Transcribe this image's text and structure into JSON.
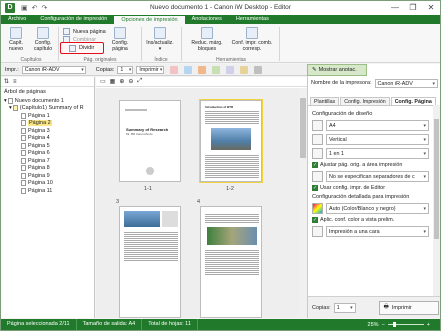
{
  "window": {
    "app_icon": "D",
    "title": "Nuevo documento 1 - Canon iW Desktop - Editor",
    "quick_access": [
      "save-icon",
      "undo-icon",
      "redo-icon"
    ],
    "controls": [
      "—",
      "❐",
      "✕"
    ]
  },
  "tabs": [
    {
      "label": "Archivo",
      "active": false
    },
    {
      "label": "Configuración de impresión",
      "active": false
    },
    {
      "label": "Opciones de impresión",
      "active": true
    },
    {
      "label": "Anotaciones",
      "active": false
    },
    {
      "label": "Herramientas",
      "active": false
    }
  ],
  "ribbon": {
    "capit_nuevo": "Capít.\nnuevo",
    "config_capitulo": "Config.\ncapítulo",
    "nueva_pagina": "Nueva página",
    "combinar": "Combinar",
    "dividir": "Dividir",
    "config_pagina": "Config.\npágina",
    "ins_actualiz": "Ins/actualiz.",
    "reduc_marg": "Reduc. márg.\nbloques",
    "conf_impr_comb": "Conf. impr. comb.\ncorresp.",
    "groups": [
      "Capítulos",
      "Pág. originales",
      "Índice",
      "Herramientas"
    ]
  },
  "toolbar": {
    "impr_label": "Impr.:",
    "printer": "Canon iR-ADV",
    "copias_label": "Copias:",
    "copias_value": "1",
    "imprimir": "Imprimir",
    "mostrar_anotac": "Mostrar anotac."
  },
  "left_pane": {
    "title": "Árbol de páginas",
    "doc": "Nuevo documento 1",
    "chapter": "(Capítulo1) Summary of R",
    "pages": [
      "Página 1",
      "Página 2",
      "Página 3",
      "Página 4",
      "Página 5",
      "Página 6",
      "Página 7",
      "Página 8",
      "Página 9",
      "Página 10",
      "Página 11"
    ],
    "selected_index": 1
  },
  "thumbnails": [
    {
      "label": "1-1",
      "heading": "Summary of Research",
      "sub": "Mr. Bill Canon/Ando"
    },
    {
      "label": "1-2",
      "heading": "Introduction of BTR",
      "sub": ""
    },
    {
      "label": "3",
      "heading": "",
      "sub": ""
    },
    {
      "label": "4",
      "heading": "",
      "sub": ""
    }
  ],
  "right_pane": {
    "printer_label": "Nombre de la impresora:",
    "printer_value": "Canon iR-ADV",
    "tabs": [
      "Plantillas",
      "Config. Impresión",
      "Config. Página"
    ],
    "active_tab": 2,
    "sec_layout": "Configuración de diseño",
    "paper": "A4",
    "orientation": "Vertical",
    "n_up": "1 en 1",
    "chk_ajustar": "Ajustar pág. orig. a área impresión",
    "separators": "No se especifican separadores de c",
    "chk_usar": "Usar config. impr. de Editor",
    "sec_detailed": "Configuración detallada para impresión",
    "color_mode": "Auto (Color/Blanco y negro)",
    "chk_aplic": "Aplic. conf. color a vista prelim.",
    "duplex": "Impresión a una cara",
    "copias_label": "Copias:",
    "copias_value": "1",
    "imprimir": "Imprimir"
  },
  "status": {
    "selected": "Página seleccionada 2/11",
    "size": "Tamaño de salida: A4",
    "total": "Total de hojas: 11",
    "zoom": "25%",
    "zoom_level": 0.25
  },
  "colors": {
    "brand_green": "#217a2b",
    "highlight_red": "#e0101a",
    "selection_yellow": "#f9e686"
  }
}
